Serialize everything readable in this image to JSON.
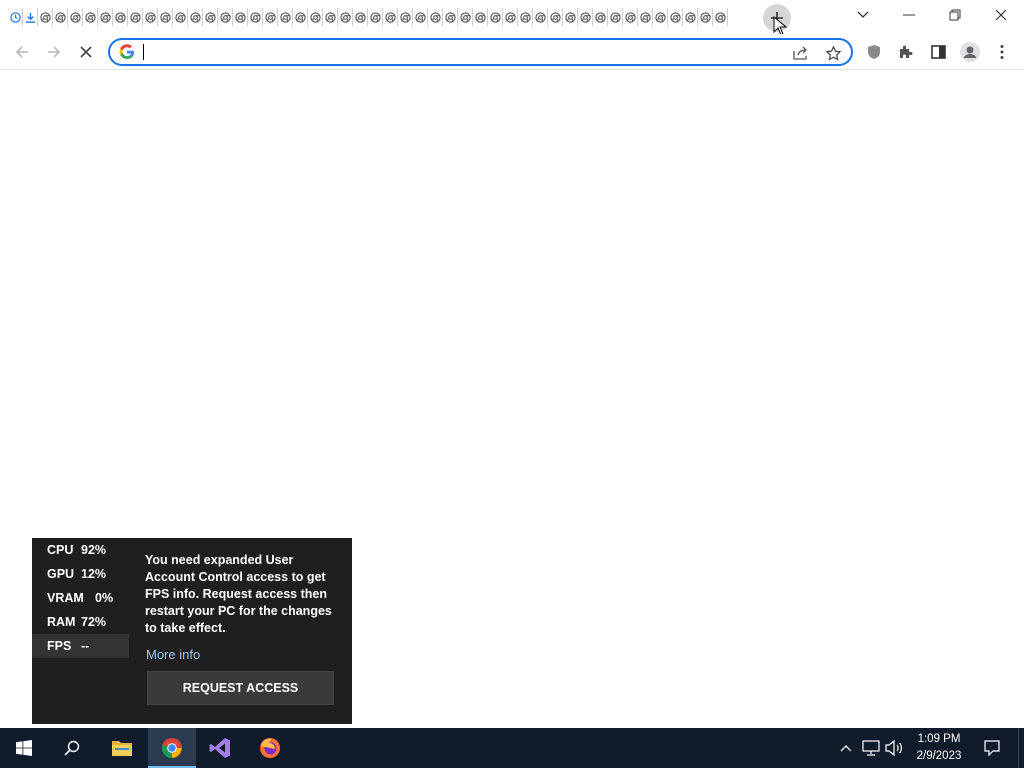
{
  "browser": {
    "tab_count": 48,
    "tab_icon": "chrome-generic-tab-icon",
    "first_tab_icons": [
      "history-icon",
      "download-icon"
    ],
    "newtab_tooltip_icon": "plus-icon",
    "omnibox": {
      "value": "",
      "placeholder": "",
      "search_engine_icon": "google-g-icon"
    },
    "toolbar_icons": [
      "back-arrow-icon",
      "forward-arrow-icon",
      "stop-loading-icon",
      "share-icon",
      "bookmark-star-icon",
      "shield-extension-icon",
      "puzzle-extensions-icon",
      "side-panel-icon",
      "profile-avatar-icon",
      "kebab-menu-icon"
    ],
    "window_controls": [
      "tab-search-chevron-icon",
      "minimize-icon",
      "restore-icon",
      "close-icon"
    ],
    "accent_color": "#1a73e8"
  },
  "gamebar": {
    "stats": [
      {
        "label": "CPU",
        "value": "92%"
      },
      {
        "label": "GPU",
        "value": "12%"
      },
      {
        "label": "VRAM",
        "value": "0%"
      },
      {
        "label": "RAM",
        "value": "72%"
      },
      {
        "label": "FPS",
        "value": "--"
      }
    ],
    "message": "You need expanded User Account Control access to get FPS info. Request access then restart your PC for the changes to take effect.",
    "more_info": "More info",
    "request_button": "REQUEST ACCESS",
    "link_color": "#99c8f5"
  },
  "taskbar": {
    "apps": [
      "windows-start-icon",
      "search-icon",
      "file-explorer-icon",
      "chrome-icon",
      "visual-studio-icon",
      "firefox-icon"
    ],
    "tray_icons": [
      "show-hidden-icons-chevron",
      "network-icon",
      "volume-icon",
      "action-center-icon"
    ],
    "time": "1:09 PM",
    "date": "2/9/2023"
  }
}
